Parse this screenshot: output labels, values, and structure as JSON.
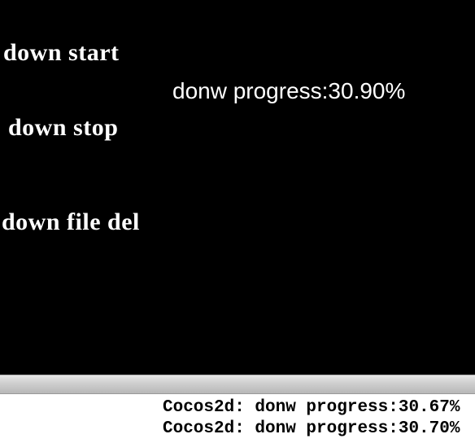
{
  "menu": {
    "start_label": "down start",
    "stop_label": "down stop",
    "del_label": "down file del"
  },
  "progress": {
    "text": "donw progress:30.90%"
  },
  "console": {
    "lines": [
      "Cocos2d: donw progress:30.67%",
      "Cocos2d: donw progress:30.70%"
    ]
  }
}
